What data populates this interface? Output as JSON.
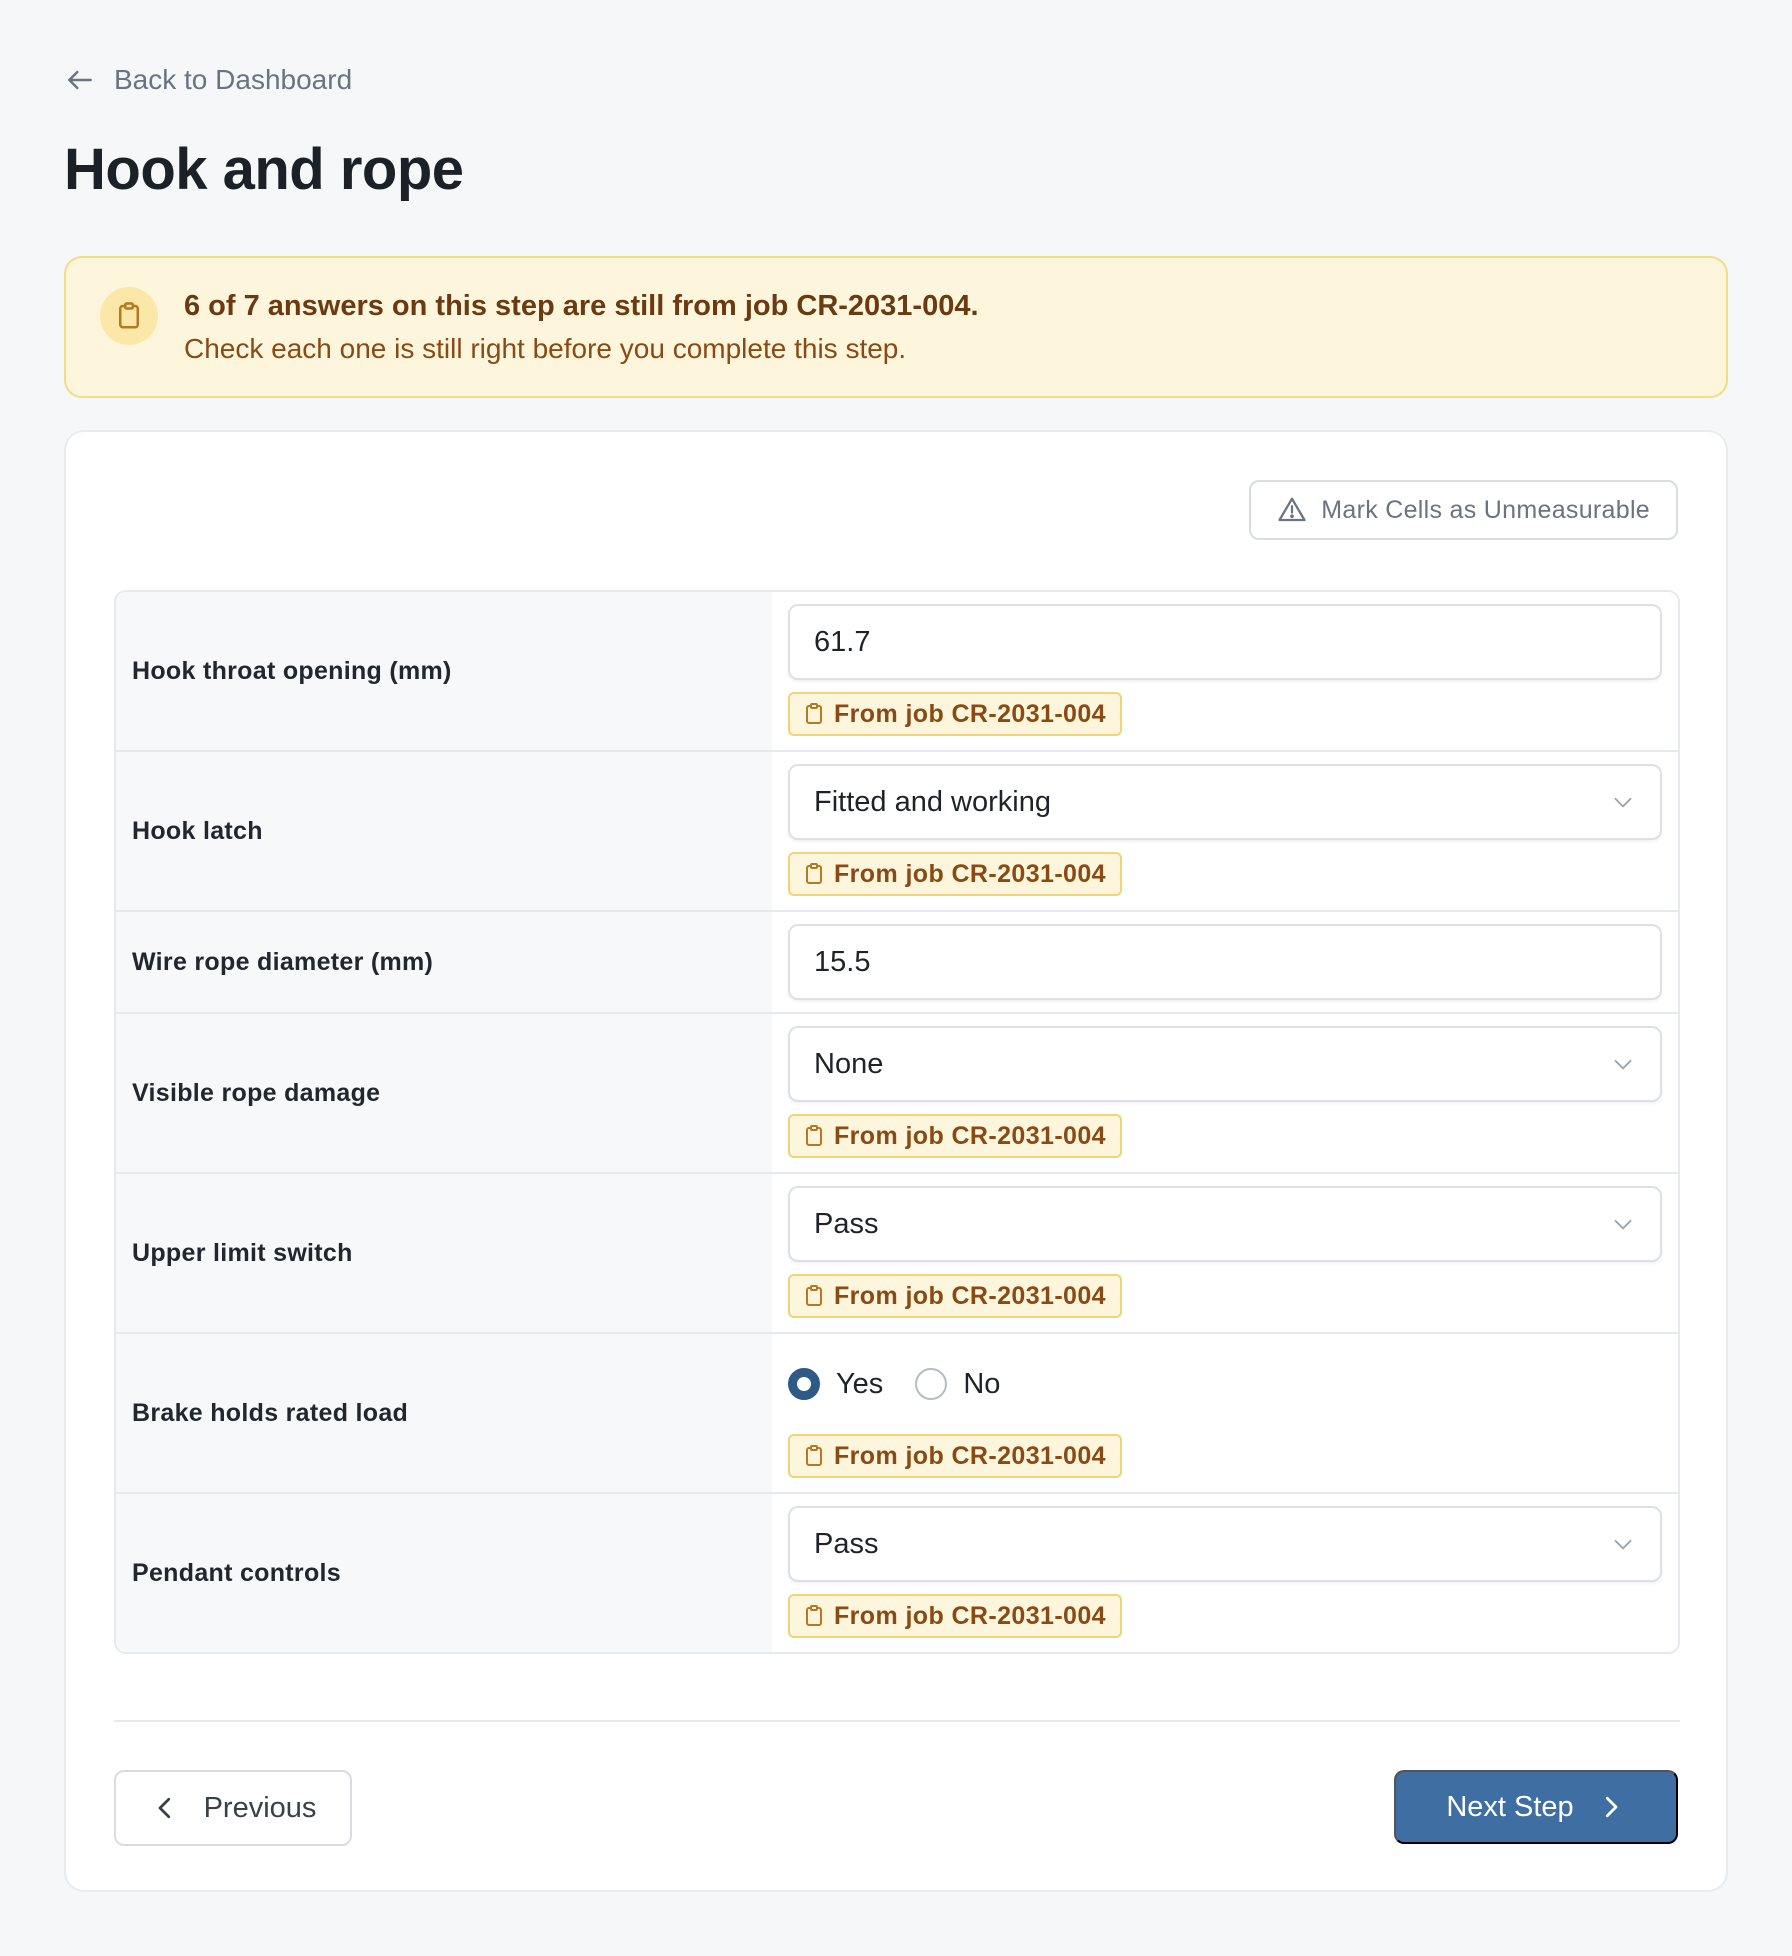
{
  "nav": {
    "back_label": "Back to Dashboard"
  },
  "page": {
    "title": "Hook and rope"
  },
  "banner": {
    "title": "6 of 7 answers on this step are still from job CR-2031-004.",
    "subtitle": "Check each one is still right before you complete this step.",
    "icon": "clipboard-icon"
  },
  "toolbar": {
    "mark_unmeasurable_label": "Mark Cells as Unmeasurable",
    "mark_icon": "warning-triangle-icon"
  },
  "rows": [
    {
      "label": "Hook throat opening (mm)",
      "type": "text",
      "value": "61.7",
      "badge": "From job CR-2031-004"
    },
    {
      "label": "Hook latch",
      "type": "select",
      "value": "Fitted and working",
      "badge": "From job CR-2031-004"
    },
    {
      "label": "Wire rope diameter (mm)",
      "type": "text",
      "value": "15.5",
      "badge": ""
    },
    {
      "label": "Visible rope damage",
      "type": "select",
      "value": "None",
      "badge": "From job CR-2031-004"
    },
    {
      "label": "Upper limit switch",
      "type": "select",
      "value": "Pass",
      "badge": "From job CR-2031-004"
    },
    {
      "label": "Brake holds rated load",
      "type": "radio",
      "options": [
        "Yes",
        "No"
      ],
      "selected": "Yes",
      "badge": "From job CR-2031-004"
    },
    {
      "label": "Pendant controls",
      "type": "select",
      "value": "Pass",
      "badge": "From job CR-2031-004"
    }
  ],
  "footer": {
    "previous_label": "Previous",
    "next_label": "Next Step"
  },
  "colors": {
    "accent": "#3e6ea2",
    "banner_bg": "#fdf6dd",
    "banner_border": "#f3dc86",
    "badge_text": "#8a4a14",
    "radio_checked": "#2f5a85"
  }
}
